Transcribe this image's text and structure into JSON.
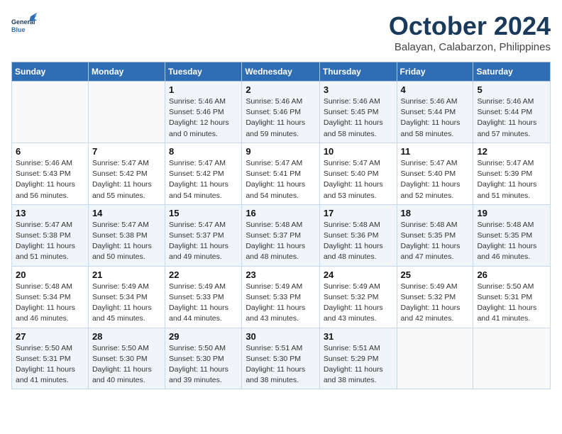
{
  "header": {
    "logo_line1": "General",
    "logo_line2": "Blue",
    "month": "October 2024",
    "location": "Balayan, Calabarzon, Philippines"
  },
  "weekdays": [
    "Sunday",
    "Monday",
    "Tuesday",
    "Wednesday",
    "Thursday",
    "Friday",
    "Saturday"
  ],
  "weeks": [
    [
      {
        "day": "",
        "info": ""
      },
      {
        "day": "",
        "info": ""
      },
      {
        "day": "1",
        "info": "Sunrise: 5:46 AM\nSunset: 5:46 PM\nDaylight: 12 hours\nand 0 minutes."
      },
      {
        "day": "2",
        "info": "Sunrise: 5:46 AM\nSunset: 5:46 PM\nDaylight: 11 hours\nand 59 minutes."
      },
      {
        "day": "3",
        "info": "Sunrise: 5:46 AM\nSunset: 5:45 PM\nDaylight: 11 hours\nand 58 minutes."
      },
      {
        "day": "4",
        "info": "Sunrise: 5:46 AM\nSunset: 5:44 PM\nDaylight: 11 hours\nand 58 minutes."
      },
      {
        "day": "5",
        "info": "Sunrise: 5:46 AM\nSunset: 5:44 PM\nDaylight: 11 hours\nand 57 minutes."
      }
    ],
    [
      {
        "day": "6",
        "info": "Sunrise: 5:46 AM\nSunset: 5:43 PM\nDaylight: 11 hours\nand 56 minutes."
      },
      {
        "day": "7",
        "info": "Sunrise: 5:47 AM\nSunset: 5:42 PM\nDaylight: 11 hours\nand 55 minutes."
      },
      {
        "day": "8",
        "info": "Sunrise: 5:47 AM\nSunset: 5:42 PM\nDaylight: 11 hours\nand 54 minutes."
      },
      {
        "day": "9",
        "info": "Sunrise: 5:47 AM\nSunset: 5:41 PM\nDaylight: 11 hours\nand 54 minutes."
      },
      {
        "day": "10",
        "info": "Sunrise: 5:47 AM\nSunset: 5:40 PM\nDaylight: 11 hours\nand 53 minutes."
      },
      {
        "day": "11",
        "info": "Sunrise: 5:47 AM\nSunset: 5:40 PM\nDaylight: 11 hours\nand 52 minutes."
      },
      {
        "day": "12",
        "info": "Sunrise: 5:47 AM\nSunset: 5:39 PM\nDaylight: 11 hours\nand 51 minutes."
      }
    ],
    [
      {
        "day": "13",
        "info": "Sunrise: 5:47 AM\nSunset: 5:38 PM\nDaylight: 11 hours\nand 51 minutes."
      },
      {
        "day": "14",
        "info": "Sunrise: 5:47 AM\nSunset: 5:38 PM\nDaylight: 11 hours\nand 50 minutes."
      },
      {
        "day": "15",
        "info": "Sunrise: 5:47 AM\nSunset: 5:37 PM\nDaylight: 11 hours\nand 49 minutes."
      },
      {
        "day": "16",
        "info": "Sunrise: 5:48 AM\nSunset: 5:37 PM\nDaylight: 11 hours\nand 48 minutes."
      },
      {
        "day": "17",
        "info": "Sunrise: 5:48 AM\nSunset: 5:36 PM\nDaylight: 11 hours\nand 48 minutes."
      },
      {
        "day": "18",
        "info": "Sunrise: 5:48 AM\nSunset: 5:35 PM\nDaylight: 11 hours\nand 47 minutes."
      },
      {
        "day": "19",
        "info": "Sunrise: 5:48 AM\nSunset: 5:35 PM\nDaylight: 11 hours\nand 46 minutes."
      }
    ],
    [
      {
        "day": "20",
        "info": "Sunrise: 5:48 AM\nSunset: 5:34 PM\nDaylight: 11 hours\nand 46 minutes."
      },
      {
        "day": "21",
        "info": "Sunrise: 5:49 AM\nSunset: 5:34 PM\nDaylight: 11 hours\nand 45 minutes."
      },
      {
        "day": "22",
        "info": "Sunrise: 5:49 AM\nSunset: 5:33 PM\nDaylight: 11 hours\nand 44 minutes."
      },
      {
        "day": "23",
        "info": "Sunrise: 5:49 AM\nSunset: 5:33 PM\nDaylight: 11 hours\nand 43 minutes."
      },
      {
        "day": "24",
        "info": "Sunrise: 5:49 AM\nSunset: 5:32 PM\nDaylight: 11 hours\nand 43 minutes."
      },
      {
        "day": "25",
        "info": "Sunrise: 5:49 AM\nSunset: 5:32 PM\nDaylight: 11 hours\nand 42 minutes."
      },
      {
        "day": "26",
        "info": "Sunrise: 5:50 AM\nSunset: 5:31 PM\nDaylight: 11 hours\nand 41 minutes."
      }
    ],
    [
      {
        "day": "27",
        "info": "Sunrise: 5:50 AM\nSunset: 5:31 PM\nDaylight: 11 hours\nand 41 minutes."
      },
      {
        "day": "28",
        "info": "Sunrise: 5:50 AM\nSunset: 5:30 PM\nDaylight: 11 hours\nand 40 minutes."
      },
      {
        "day": "29",
        "info": "Sunrise: 5:50 AM\nSunset: 5:30 PM\nDaylight: 11 hours\nand 39 minutes."
      },
      {
        "day": "30",
        "info": "Sunrise: 5:51 AM\nSunset: 5:30 PM\nDaylight: 11 hours\nand 38 minutes."
      },
      {
        "day": "31",
        "info": "Sunrise: 5:51 AM\nSunset: 5:29 PM\nDaylight: 11 hours\nand 38 minutes."
      },
      {
        "day": "",
        "info": ""
      },
      {
        "day": "",
        "info": ""
      }
    ]
  ]
}
